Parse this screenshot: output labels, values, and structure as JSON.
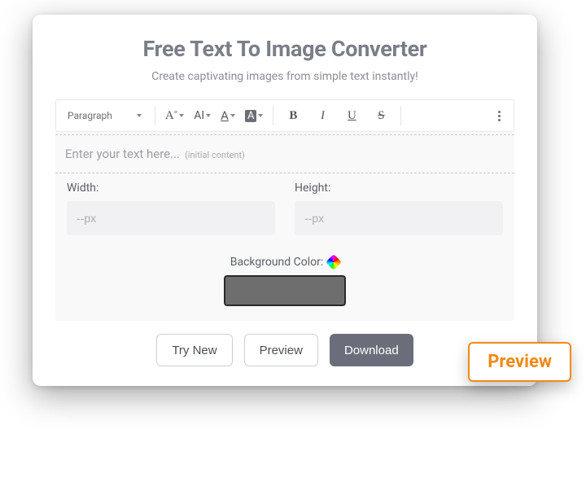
{
  "title": "Free Text To Image Converter",
  "subtitle": "Create captivating images from simple text instantly!",
  "toolbar": {
    "paragraph_label": "Paragraph",
    "font_family_icon": "A",
    "font_size_icon": "AI",
    "text_color_icon": "A",
    "highlight_icon": "A",
    "bold": "B",
    "italic": "I",
    "underline": "U",
    "strike": "S"
  },
  "editor": {
    "placeholder": "Enter your text here...",
    "hint": "(initial content)"
  },
  "dimensions": {
    "width_label": "Width:",
    "height_label": "Height:",
    "placeholder": "--px"
  },
  "background": {
    "label": "Background Color:",
    "value": "#6e6e6e"
  },
  "buttons": {
    "try_new": "Try New",
    "preview": "Preview",
    "download": "Download"
  },
  "badge": {
    "preview": "Preview"
  }
}
